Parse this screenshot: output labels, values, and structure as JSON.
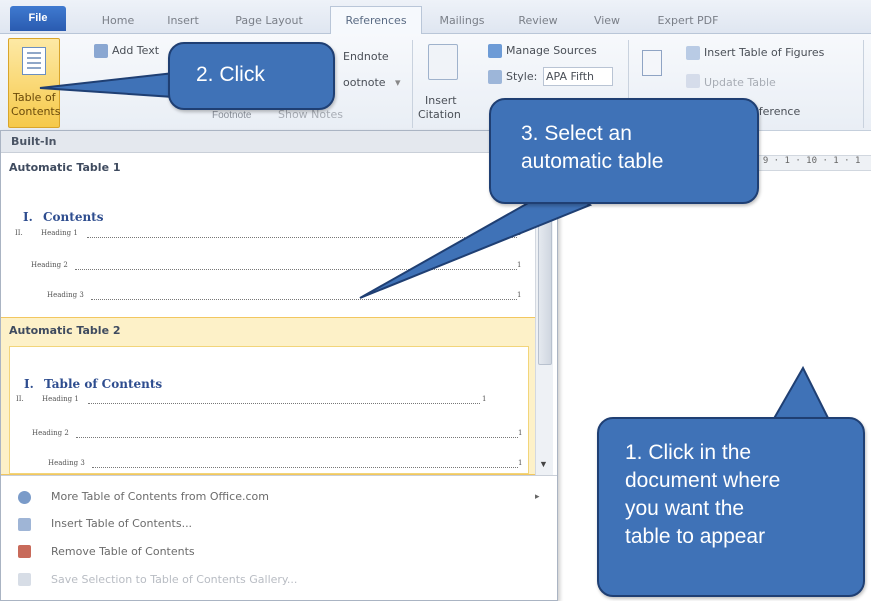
{
  "tabs": {
    "file": "File",
    "home": "Home",
    "insert": "Insert",
    "page_layout": "Page Layout",
    "references": "References",
    "mailings": "Mailings",
    "review": "Review",
    "view": "View",
    "expert_pdf": "Expert PDF"
  },
  "ribbon": {
    "toc_button_line1": "Table of",
    "toc_button_line2": "Contents",
    "add_text": "Add Text",
    "endnote": "Endnote",
    "footnote_next": "ootnote",
    "show_notes": "Show Notes",
    "footnotes_group": "Footnote",
    "insert_citation_line1": "Insert",
    "insert_citation_line2": "Citation",
    "manage_sources": "Manage Sources",
    "style_label": "Style:",
    "style_value": "APA Fifth",
    "insert_table_of_figures": "Insert Table of Figures",
    "update_table": "Update Table",
    "cross_reference": "eference"
  },
  "ruler": {
    "text": "· 9 · 1 · 10 · 1 · 1"
  },
  "panel": {
    "builtin": "Built-In",
    "table1": {
      "title": "Automatic Table 1",
      "heading": "Contents",
      "roman1": "I.",
      "roman2": "II.",
      "line1": "Heading 1",
      "line2": "Heading 2",
      "line3": "Heading 3",
      "page": "1"
    },
    "table2": {
      "title": "Automatic Table 2",
      "heading": "Table of Contents",
      "roman1": "I.",
      "roman2": "II.",
      "line1": "Heading 1",
      "line2": "Heading 2",
      "line3": "Heading 3",
      "page": "1"
    },
    "menu": [
      {
        "label": "More Table of Contents from Office.com",
        "enabled": true
      },
      {
        "label": "Insert Table of Contents...",
        "enabled": true
      },
      {
        "label": "Remove Table of Contents",
        "enabled": true
      },
      {
        "label": "Save Selection to Table of Contents Gallery...",
        "enabled": false
      }
    ]
  },
  "callouts": {
    "step1": [
      "1. Click in the",
      "document where",
      "you want the",
      "table to appear"
    ],
    "step2": "2. Click",
    "step3": [
      "3. Select an",
      "automatic table"
    ]
  },
  "colors": {
    "callout_fill": "#3f72b7",
    "callout_border": "#1f3f73",
    "highlight": "#fdf1c8",
    "toc_heading": "#2e4d8f"
  }
}
